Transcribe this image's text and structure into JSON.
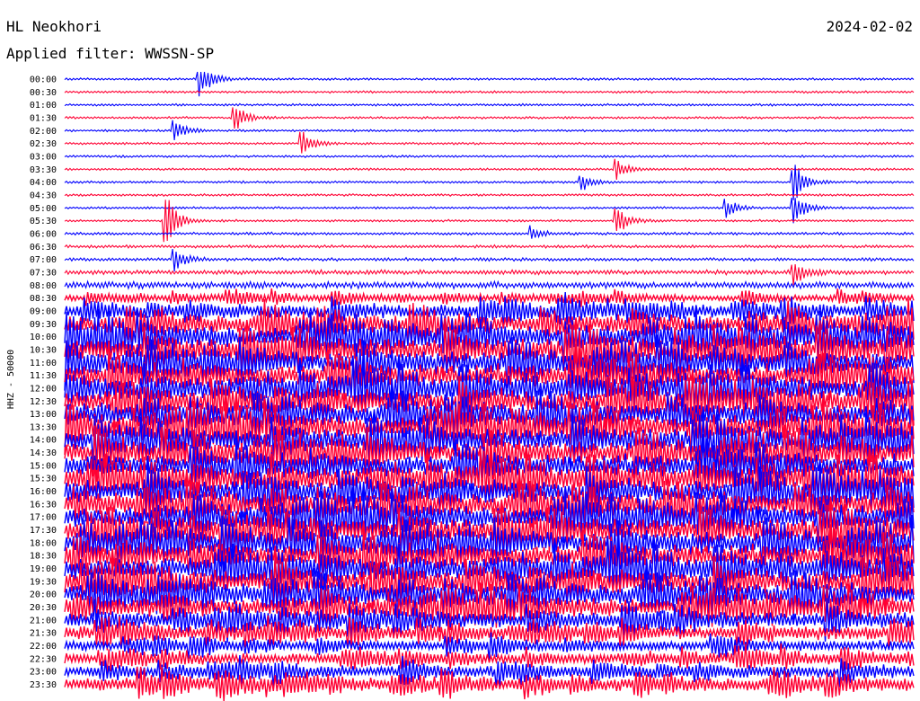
{
  "header": {
    "station": "HL Neokhori",
    "date": "2024-02-02",
    "filter": "Applied filter: WWSSN-SP"
  },
  "chart_data": {
    "type": "helicorder",
    "title": "HL Neokhori",
    "subtitle": "Applied filter: WWSSN-SP",
    "ylabel": "HHZ - 50000",
    "row_labels": [
      "00:00",
      "00:30",
      "01:00",
      "01:30",
      "02:00",
      "02:30",
      "03:00",
      "03:30",
      "04:00",
      "04:30",
      "05:00",
      "05:30",
      "06:00",
      "06:30",
      "07:00",
      "07:30",
      "08:00",
      "08:30",
      "09:00",
      "09:30",
      "10:00",
      "10:30",
      "11:00",
      "11:30",
      "12:00",
      "12:30",
      "13:00",
      "13:30",
      "14:00",
      "14:30",
      "15:00",
      "15:30",
      "16:00",
      "16:30",
      "17:00",
      "17:30",
      "18:00",
      "18:30",
      "19:00",
      "19:30",
      "20:00",
      "20:30",
      "21:00",
      "21:30",
      "22:00",
      "22:30",
      "23:00",
      "23:30"
    ],
    "trace_colors": [
      "#0000ff",
      "#ff0033"
    ],
    "noise_level_by_row": [
      1,
      1,
      1,
      1,
      1,
      1,
      1,
      1,
      1,
      1,
      1,
      1,
      1.2,
      1.3,
      1.4,
      2,
      3,
      5,
      10,
      14,
      16,
      17,
      17,
      17,
      17,
      17,
      17,
      17,
      17,
      17,
      17,
      17,
      17,
      17,
      17,
      17,
      17,
      17,
      17,
      17,
      16,
      14,
      12,
      10,
      8,
      8,
      9,
      10
    ],
    "events": [
      {
        "row": 0,
        "pos": 0.16,
        "amplitude": 25
      },
      {
        "row": 3,
        "pos": 0.2,
        "amplitude": 18
      },
      {
        "row": 4,
        "pos": 0.13,
        "amplitude": 12
      },
      {
        "row": 5,
        "pos": 0.28,
        "amplitude": 16
      },
      {
        "row": 7,
        "pos": 0.65,
        "amplitude": 12
      },
      {
        "row": 8,
        "pos": 0.61,
        "amplitude": 10
      },
      {
        "row": 8,
        "pos": 0.86,
        "amplitude": 22
      },
      {
        "row": 10,
        "pos": 0.78,
        "amplitude": 10
      },
      {
        "row": 10,
        "pos": 0.86,
        "amplitude": 18
      },
      {
        "row": 11,
        "pos": 0.12,
        "amplitude": 30
      },
      {
        "row": 11,
        "pos": 0.65,
        "amplitude": 18
      },
      {
        "row": 12,
        "pos": 0.55,
        "amplitude": 8
      },
      {
        "row": 14,
        "pos": 0.13,
        "amplitude": 14
      },
      {
        "row": 15,
        "pos": 0.86,
        "amplitude": 14
      }
    ]
  }
}
